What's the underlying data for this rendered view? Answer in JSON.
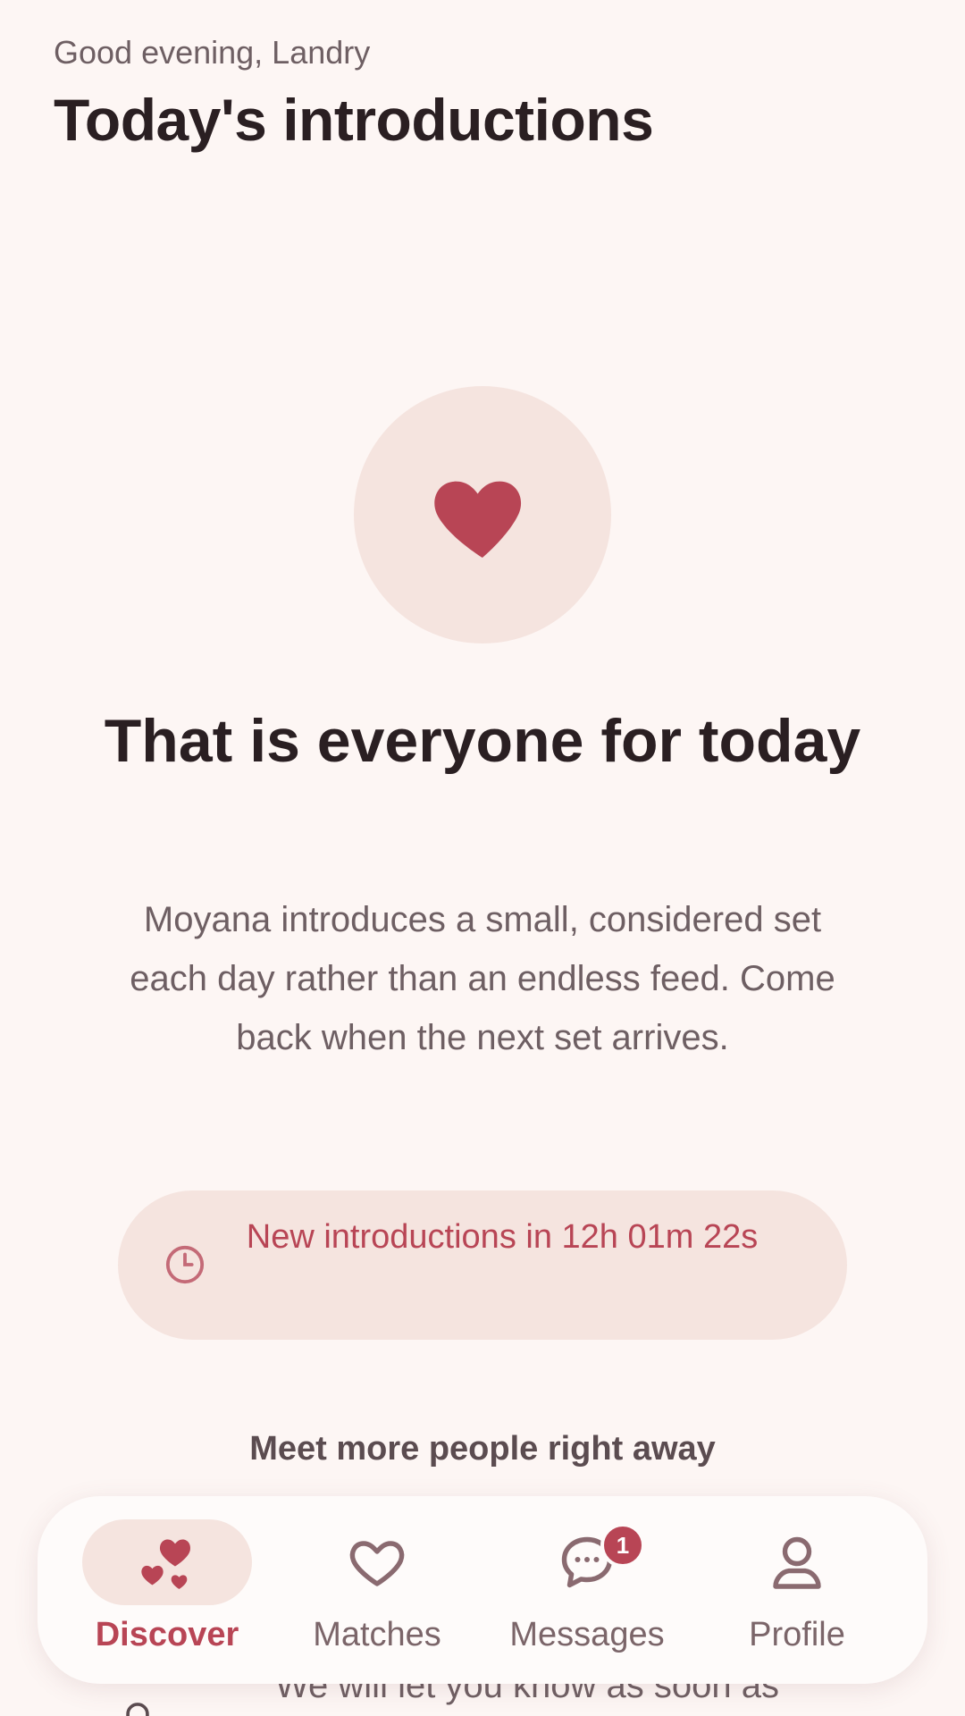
{
  "header": {
    "greeting": "Good evening, Landry",
    "title": "Today's introductions"
  },
  "empty_state": {
    "icon": "heart-icon",
    "title": "That is everyone for today",
    "body": "Moyana introduces a small, considered set each day rather than an endless feed. Come back when the next set arrives."
  },
  "countdown": {
    "icon": "clock-icon",
    "text": "New introductions in 12h 01m 22s"
  },
  "meet_more": {
    "label": "Meet more people right away"
  },
  "notify": {
    "icon": "bell-icon",
    "text": "We will let you know as soon as"
  },
  "nav": {
    "items": [
      {
        "label": "Discover",
        "icon": "hearts-icon",
        "active": true
      },
      {
        "label": "Matches",
        "icon": "heart-outline-icon",
        "active": false
      },
      {
        "label": "Messages",
        "icon": "chat-bubble-icon",
        "active": false,
        "badge": "1"
      },
      {
        "label": "Profile",
        "icon": "person-icon",
        "active": false
      }
    ]
  },
  "colors": {
    "background": "#fdf6f4",
    "accent": "#b84555",
    "accent_soft": "#f5e4df",
    "text_primary": "#2a1f22",
    "text_secondary": "#6e5f63"
  }
}
